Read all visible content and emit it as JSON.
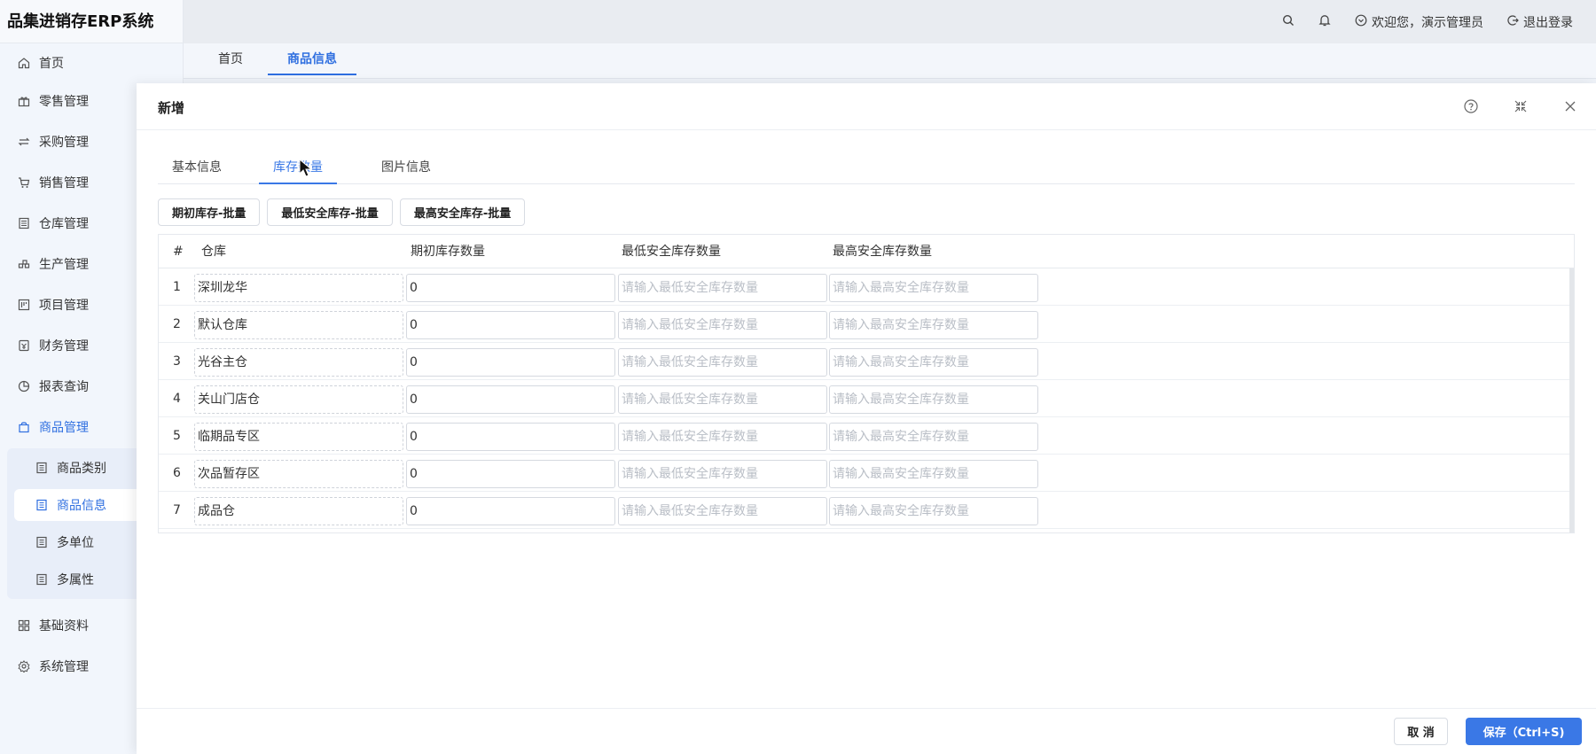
{
  "app": {
    "title": "品集进销存ERP系统"
  },
  "sidebar": {
    "items": [
      {
        "label": "首页",
        "icon": "home-icon"
      },
      {
        "label": "零售管理",
        "icon": "gift-icon"
      },
      {
        "label": "采购管理",
        "icon": "swap-icon"
      },
      {
        "label": "销售管理",
        "icon": "cart-icon"
      },
      {
        "label": "仓库管理",
        "icon": "warehouse-icon"
      },
      {
        "label": "生产管理",
        "icon": "production-icon"
      },
      {
        "label": "项目管理",
        "icon": "project-icon"
      },
      {
        "label": "财务管理",
        "icon": "finance-icon"
      },
      {
        "label": "报表查询",
        "icon": "pie-chart-icon"
      },
      {
        "label": "商品管理",
        "icon": "bag-icon"
      },
      {
        "label": "基础资料",
        "icon": "grid-icon"
      },
      {
        "label": "系统管理",
        "icon": "gear-icon"
      }
    ],
    "sub_items": [
      {
        "label": "商品类别"
      },
      {
        "label": "商品信息"
      },
      {
        "label": "多单位"
      },
      {
        "label": "多属性"
      }
    ]
  },
  "header": {
    "welcome": "欢迎您，演示管理员",
    "logout": "退出登录"
  },
  "page_tabs": [
    "首页",
    "商品信息"
  ],
  "modal": {
    "title": "新增",
    "form_tabs": [
      "基本信息",
      "库存数量",
      "图片信息"
    ],
    "batch_buttons": [
      "期初库存-批量",
      "最低安全库存-批量",
      "最高安全库存-批量"
    ],
    "columns": [
      "#",
      "仓库",
      "期初库存数量",
      "最低安全库存数量",
      "最高安全库存数量"
    ],
    "min_placeholder": "请输入最低安全库存数量",
    "max_placeholder": "请输入最高安全库存数量",
    "rows": [
      {
        "no": "1",
        "warehouse": "深圳龙华",
        "initial": "0"
      },
      {
        "no": "2",
        "warehouse": "默认仓库",
        "initial": "0"
      },
      {
        "no": "3",
        "warehouse": "光谷主仓",
        "initial": "0"
      },
      {
        "no": "4",
        "warehouse": "关山门店仓",
        "initial": "0"
      },
      {
        "no": "5",
        "warehouse": "临期品专区",
        "initial": "0"
      },
      {
        "no": "6",
        "warehouse": "次品暂存区",
        "initial": "0"
      },
      {
        "no": "7",
        "warehouse": "成品仓",
        "initial": "0"
      }
    ],
    "cancel_label": "取 消",
    "save_label": "保存（Ctrl+S)"
  },
  "colors": {
    "accent": "#3a78e6",
    "sidebar_bg": "#f2f6fc"
  }
}
